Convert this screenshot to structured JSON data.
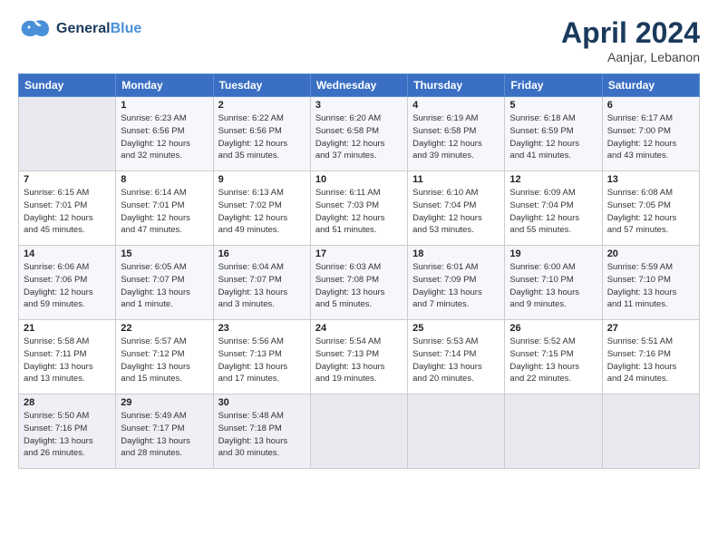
{
  "header": {
    "logo_line1": "General",
    "logo_line2": "Blue",
    "month": "April 2024",
    "location": "Aanjar, Lebanon"
  },
  "weekdays": [
    "Sunday",
    "Monday",
    "Tuesday",
    "Wednesday",
    "Thursday",
    "Friday",
    "Saturday"
  ],
  "weeks": [
    [
      {
        "day": "",
        "info": ""
      },
      {
        "day": "1",
        "info": "Sunrise: 6:23 AM\nSunset: 6:56 PM\nDaylight: 12 hours\nand 32 minutes."
      },
      {
        "day": "2",
        "info": "Sunrise: 6:22 AM\nSunset: 6:56 PM\nDaylight: 12 hours\nand 35 minutes."
      },
      {
        "day": "3",
        "info": "Sunrise: 6:20 AM\nSunset: 6:58 PM\nDaylight: 12 hours\nand 37 minutes."
      },
      {
        "day": "4",
        "info": "Sunrise: 6:19 AM\nSunset: 6:58 PM\nDaylight: 12 hours\nand 39 minutes."
      },
      {
        "day": "5",
        "info": "Sunrise: 6:18 AM\nSunset: 6:59 PM\nDaylight: 12 hours\nand 41 minutes."
      },
      {
        "day": "6",
        "info": "Sunrise: 6:17 AM\nSunset: 7:00 PM\nDaylight: 12 hours\nand 43 minutes."
      }
    ],
    [
      {
        "day": "7",
        "info": "Sunrise: 6:15 AM\nSunset: 7:01 PM\nDaylight: 12 hours\nand 45 minutes."
      },
      {
        "day": "8",
        "info": "Sunrise: 6:14 AM\nSunset: 7:01 PM\nDaylight: 12 hours\nand 47 minutes."
      },
      {
        "day": "9",
        "info": "Sunrise: 6:13 AM\nSunset: 7:02 PM\nDaylight: 12 hours\nand 49 minutes."
      },
      {
        "day": "10",
        "info": "Sunrise: 6:11 AM\nSunset: 7:03 PM\nDaylight: 12 hours\nand 51 minutes."
      },
      {
        "day": "11",
        "info": "Sunrise: 6:10 AM\nSunset: 7:04 PM\nDaylight: 12 hours\nand 53 minutes."
      },
      {
        "day": "12",
        "info": "Sunrise: 6:09 AM\nSunset: 7:04 PM\nDaylight: 12 hours\nand 55 minutes."
      },
      {
        "day": "13",
        "info": "Sunrise: 6:08 AM\nSunset: 7:05 PM\nDaylight: 12 hours\nand 57 minutes."
      }
    ],
    [
      {
        "day": "14",
        "info": "Sunrise: 6:06 AM\nSunset: 7:06 PM\nDaylight: 12 hours\nand 59 minutes."
      },
      {
        "day": "15",
        "info": "Sunrise: 6:05 AM\nSunset: 7:07 PM\nDaylight: 13 hours\nand 1 minute."
      },
      {
        "day": "16",
        "info": "Sunrise: 6:04 AM\nSunset: 7:07 PM\nDaylight: 13 hours\nand 3 minutes."
      },
      {
        "day": "17",
        "info": "Sunrise: 6:03 AM\nSunset: 7:08 PM\nDaylight: 13 hours\nand 5 minutes."
      },
      {
        "day": "18",
        "info": "Sunrise: 6:01 AM\nSunset: 7:09 PM\nDaylight: 13 hours\nand 7 minutes."
      },
      {
        "day": "19",
        "info": "Sunrise: 6:00 AM\nSunset: 7:10 PM\nDaylight: 13 hours\nand 9 minutes."
      },
      {
        "day": "20",
        "info": "Sunrise: 5:59 AM\nSunset: 7:10 PM\nDaylight: 13 hours\nand 11 minutes."
      }
    ],
    [
      {
        "day": "21",
        "info": "Sunrise: 5:58 AM\nSunset: 7:11 PM\nDaylight: 13 hours\nand 13 minutes."
      },
      {
        "day": "22",
        "info": "Sunrise: 5:57 AM\nSunset: 7:12 PM\nDaylight: 13 hours\nand 15 minutes."
      },
      {
        "day": "23",
        "info": "Sunrise: 5:56 AM\nSunset: 7:13 PM\nDaylight: 13 hours\nand 17 minutes."
      },
      {
        "day": "24",
        "info": "Sunrise: 5:54 AM\nSunset: 7:13 PM\nDaylight: 13 hours\nand 19 minutes."
      },
      {
        "day": "25",
        "info": "Sunrise: 5:53 AM\nSunset: 7:14 PM\nDaylight: 13 hours\nand 20 minutes."
      },
      {
        "day": "26",
        "info": "Sunrise: 5:52 AM\nSunset: 7:15 PM\nDaylight: 13 hours\nand 22 minutes."
      },
      {
        "day": "27",
        "info": "Sunrise: 5:51 AM\nSunset: 7:16 PM\nDaylight: 13 hours\nand 24 minutes."
      }
    ],
    [
      {
        "day": "28",
        "info": "Sunrise: 5:50 AM\nSunset: 7:16 PM\nDaylight: 13 hours\nand 26 minutes."
      },
      {
        "day": "29",
        "info": "Sunrise: 5:49 AM\nSunset: 7:17 PM\nDaylight: 13 hours\nand 28 minutes."
      },
      {
        "day": "30",
        "info": "Sunrise: 5:48 AM\nSunset: 7:18 PM\nDaylight: 13 hours\nand 30 minutes."
      },
      {
        "day": "",
        "info": ""
      },
      {
        "day": "",
        "info": ""
      },
      {
        "day": "",
        "info": ""
      },
      {
        "day": "",
        "info": ""
      }
    ]
  ]
}
